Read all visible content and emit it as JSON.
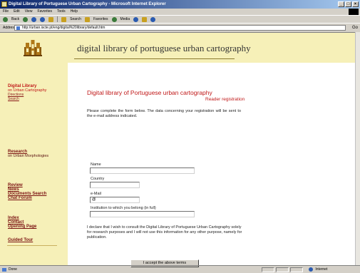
{
  "window": {
    "title": "Digital Library of Portuguese Urban Cartography - Microsoft Internet Explorer"
  },
  "menu": [
    "File",
    "Edit",
    "View",
    "Favorites",
    "Tools",
    "Help"
  ],
  "toolbar": {
    "back": "Back",
    "search": "Search",
    "favorites": "Favorites",
    "media": "Media"
  },
  "address": {
    "label": "Address",
    "url": "http://urban.iscte.pt/eng/digital%20library/default.htm",
    "go": "Go"
  },
  "header": {
    "title": "digital library of portuguese urban cartography"
  },
  "sidebar": {
    "dl_title": "Digital Library",
    "dl_subtitle": "on Urban Cartography",
    "dl_links": [
      "Directions",
      "Search"
    ],
    "research_title": "Research",
    "research_subtitle": "on Urban Morphologies",
    "links": [
      "Review",
      "News",
      "Documents Search",
      "Chat Forum"
    ],
    "links2": [
      "Index",
      "Contact",
      "Opening Page"
    ],
    "guided_tour": "Guided Tour"
  },
  "main": {
    "title": "Digital library of Portuguese urban cartography",
    "subtitle": "Reader registration",
    "intro": "Please complete the form below. The data concerning your registration will be sent to the e-mail address indicated.",
    "fields": {
      "name_label": "Name",
      "name_value": "",
      "country_label": "Country",
      "country_value": "",
      "email_label": "e-Mail",
      "email_value": "@",
      "institution_label": "Institution to which you belong (in full)",
      "institution_value": ""
    },
    "declaration": "I declare that I wish to consult the Digital Library of Portuguese Urban Cartography solely for research purposes and I will not use this information for any other purpose, namely for publication.",
    "accept_button": "I accept the above terms"
  },
  "status": {
    "text": "Done",
    "zone": "Internet"
  }
}
